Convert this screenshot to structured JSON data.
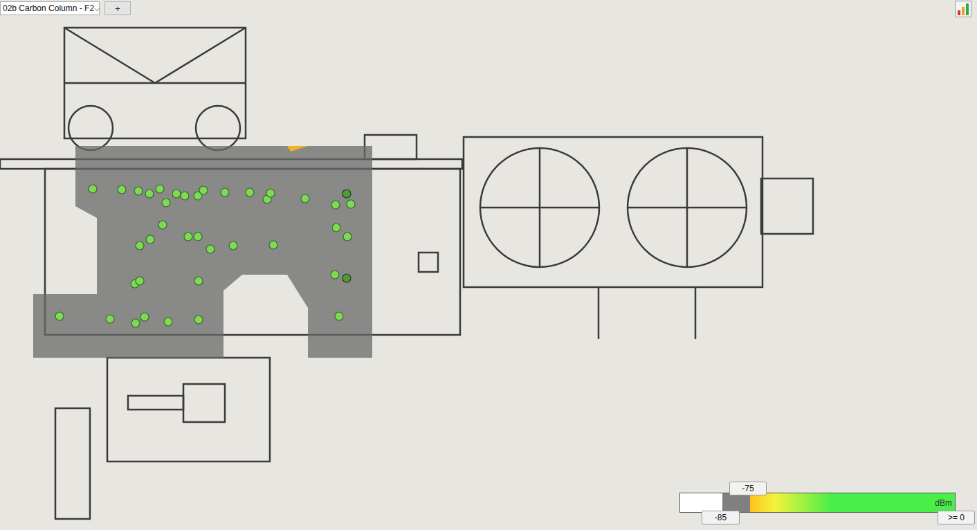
{
  "floor_selector": {
    "value": "02b Carbon Column - F2",
    "arrow": "⌵"
  },
  "add_button": {
    "label": "+"
  },
  "legend": {
    "threshold_high": "-75",
    "threshold_low": "-85",
    "max": ">= 0",
    "unit": "dBm"
  },
  "survey_points": [
    {
      "selected": false
    },
    {
      "selected": false
    },
    {
      "selected": false
    },
    {
      "selected": false
    },
    {
      "selected": false
    },
    {
      "selected": false
    },
    {
      "selected": false
    },
    {
      "selected": false
    },
    {
      "selected": false
    },
    {
      "selected": false
    },
    {
      "selected": false
    },
    {
      "selected": false
    },
    {
      "selected": false
    },
    {
      "selected": false
    },
    {
      "selected": false
    },
    {
      "selected": false
    },
    {
      "selected": true
    },
    {
      "selected": false
    },
    {
      "selected": false
    },
    {
      "selected": false
    },
    {
      "selected": false
    },
    {
      "selected": false
    },
    {
      "selected": false
    },
    {
      "selected": false
    },
    {
      "selected": false
    },
    {
      "selected": false
    },
    {
      "selected": false
    },
    {
      "selected": false
    },
    {
      "selected": false
    },
    {
      "selected": false
    },
    {
      "selected": false
    },
    {
      "selected": false
    },
    {
      "selected": true
    },
    {
      "selected": false
    },
    {
      "selected": false
    },
    {
      "selected": false
    },
    {
      "selected": false
    },
    {
      "selected": false
    },
    {
      "selected": false
    },
    {
      "selected": false
    }
  ]
}
